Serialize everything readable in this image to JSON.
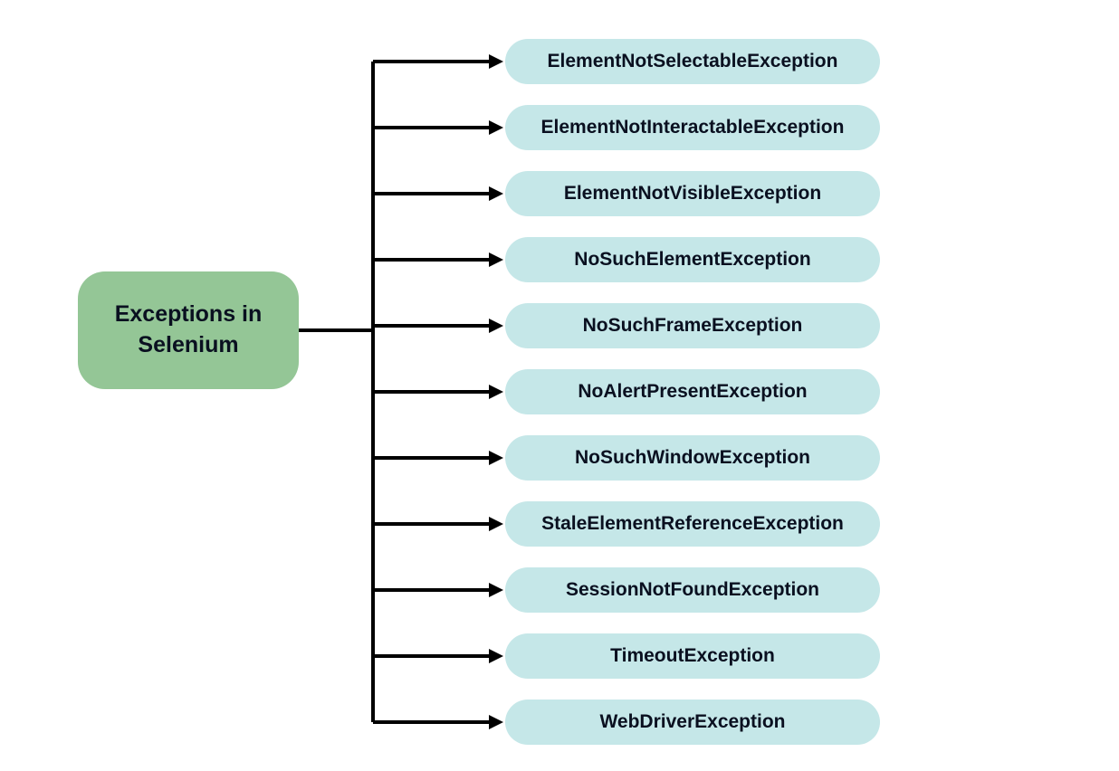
{
  "root": {
    "label": "Exceptions in Selenium"
  },
  "exceptions": [
    {
      "label": "ElementNotSelectableException"
    },
    {
      "label": "ElementNotInteractableException"
    },
    {
      "label": "ElementNotVisibleException"
    },
    {
      "label": "NoSuchElementException"
    },
    {
      "label": "NoSuchFrameException"
    },
    {
      "label": "NoAlertPresentException"
    },
    {
      "label": "NoSuchWindowException"
    },
    {
      "label": "StaleElementReferenceException"
    },
    {
      "label": "SessionNotFoundException"
    },
    {
      "label": "TimeoutException"
    },
    {
      "label": "WebDriverException"
    }
  ],
  "layout": {
    "rootRight": 330,
    "trunkX": 412,
    "listLeft": 558,
    "firstItemTop": 43,
    "itemHeight": 50,
    "itemGap": 23,
    "rootMidY": 365
  }
}
